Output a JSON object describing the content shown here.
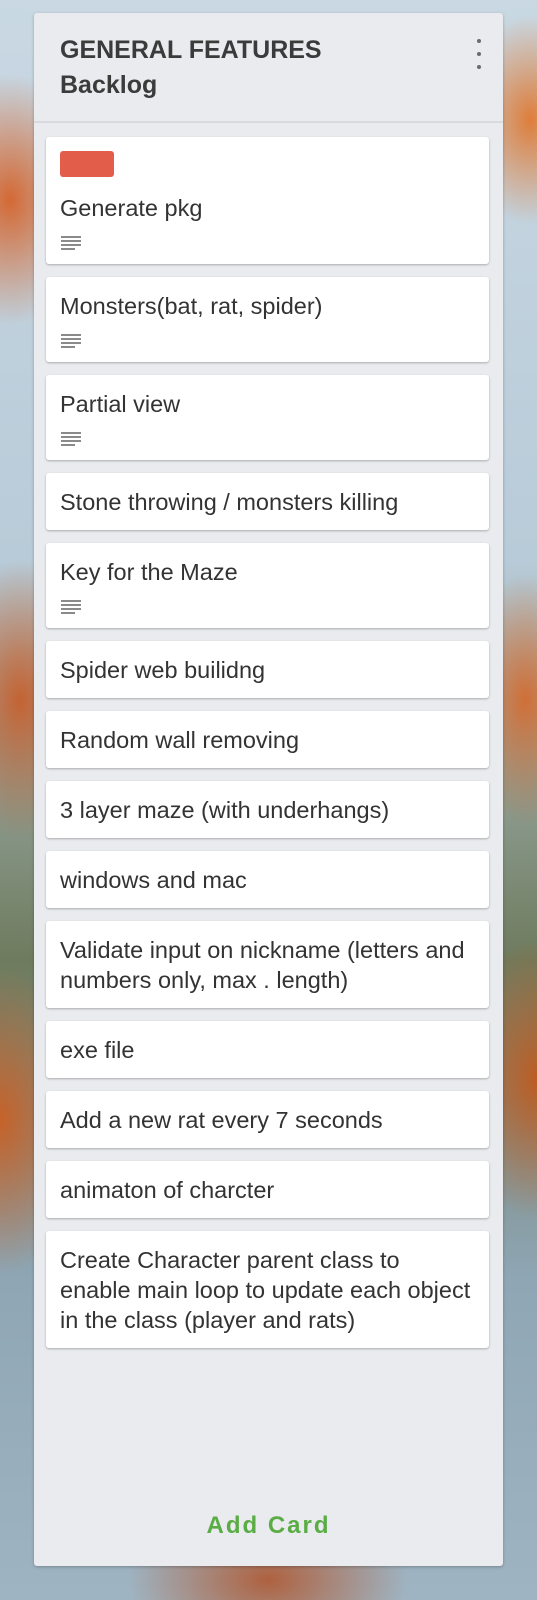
{
  "list": {
    "title": "GENERAL FEATURES\nBacklog",
    "menu_icon": "vertical-dots-icon",
    "add_card_label": "Add Card"
  },
  "colors": {
    "label_red": "#e35d4b",
    "add_card_green": "#5aac44",
    "list_background": "#e9ebee"
  },
  "cards": [
    {
      "title": "Generate pkg",
      "label_color": "#e35d4b",
      "has_description": true
    },
    {
      "title": "Monsters(bat, rat, spider)",
      "has_description": true
    },
    {
      "title": "Partial view",
      "has_description": true
    },
    {
      "title": "Stone throwing / monsters killing",
      "has_description": false
    },
    {
      "title": "Key for the Maze",
      "has_description": true
    },
    {
      "title": "Spider web builidng",
      "has_description": false
    },
    {
      "title": "Random wall removing",
      "has_description": false
    },
    {
      "title": "3 layer maze (with underhangs)",
      "has_description": false
    },
    {
      "title": "windows and mac",
      "has_description": false
    },
    {
      "title": "Validate input on nickname (letters and numbers only, max . length)",
      "has_description": false
    },
    {
      "title": "exe file",
      "has_description": false
    },
    {
      "title": "Add a new rat every 7 seconds",
      "has_description": false
    },
    {
      "title": "animaton of charcter",
      "has_description": false
    },
    {
      "title": "Create Character parent class to enable main loop to update each object in the class (player and rats)",
      "has_description": false
    }
  ]
}
